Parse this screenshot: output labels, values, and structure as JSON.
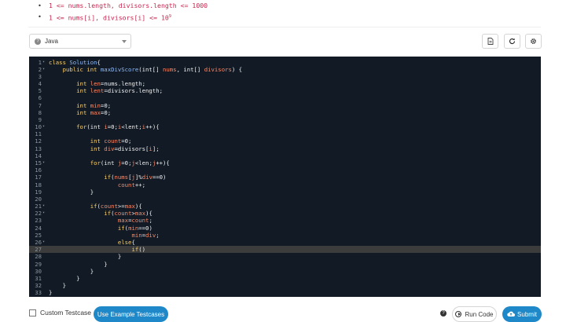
{
  "constraints": [
    {
      "text": "1 <= nums.length, divisors.length <= 1000"
    },
    {
      "text": "1 <= nums[i], divisors[i] <= 10",
      "sup": "9"
    }
  ],
  "language": {
    "selected": "Java"
  },
  "toolbar": {
    "file_icon": "file-icon",
    "refresh_icon": "refresh-icon",
    "settings_icon": "gear-icon"
  },
  "editor": {
    "active_line": 27,
    "lines": [
      {
        "n": "1",
        "fold": true,
        "t": [
          [
            "kw",
            "class "
          ],
          [
            "cls",
            "Solution"
          ],
          [
            "",
            "{"
          ]
        ]
      },
      {
        "n": "2",
        "fold": true,
        "t": [
          [
            "",
            "    "
          ],
          [
            "kw",
            "public int "
          ],
          [
            "cls",
            "maxDivScore"
          ],
          [
            "",
            "(int[] "
          ],
          [
            "id",
            "nums"
          ],
          [
            "",
            ", int[] "
          ],
          [
            "id",
            "divisors"
          ],
          [
            "",
            ") {"
          ]
        ]
      },
      {
        "n": "3",
        "t": []
      },
      {
        "n": "4",
        "t": [
          [
            "",
            "        "
          ],
          [
            "kw",
            "int "
          ],
          [
            "id",
            "len"
          ],
          [
            "",
            "=nums.length;"
          ]
        ]
      },
      {
        "n": "5",
        "t": [
          [
            "",
            "        "
          ],
          [
            "kw",
            "int "
          ],
          [
            "id",
            "lent"
          ],
          [
            "",
            "=divisors.length;"
          ]
        ]
      },
      {
        "n": "6",
        "t": []
      },
      {
        "n": "7",
        "t": [
          [
            "",
            "        "
          ],
          [
            "kw",
            "int "
          ],
          [
            "id",
            "min"
          ],
          [
            "",
            "=0;"
          ]
        ]
      },
      {
        "n": "8",
        "t": [
          [
            "",
            "        "
          ],
          [
            "kw",
            "int "
          ],
          [
            "id",
            "max"
          ],
          [
            "",
            "=0;"
          ]
        ]
      },
      {
        "n": "9",
        "t": []
      },
      {
        "n": "10",
        "fold": true,
        "t": [
          [
            "",
            "        "
          ],
          [
            "kw",
            "for"
          ],
          [
            "",
            "(int "
          ],
          [
            "id",
            "i"
          ],
          [
            "",
            "=0;"
          ],
          [
            "id",
            "i"
          ],
          [
            "",
            "<lent;"
          ],
          [
            "id",
            "i"
          ],
          [
            "",
            "++){"
          ]
        ]
      },
      {
        "n": "11",
        "t": []
      },
      {
        "n": "12",
        "t": [
          [
            "",
            "            "
          ],
          [
            "kw",
            "int "
          ],
          [
            "id",
            "count"
          ],
          [
            "",
            "=0;"
          ]
        ]
      },
      {
        "n": "13",
        "t": [
          [
            "",
            "            "
          ],
          [
            "kw",
            "int "
          ],
          [
            "id",
            "div"
          ],
          [
            "",
            "=divisors["
          ],
          [
            "id",
            "i"
          ],
          [
            "",
            "];"
          ]
        ]
      },
      {
        "n": "14",
        "t": []
      },
      {
        "n": "15",
        "fold": true,
        "t": [
          [
            "",
            "            "
          ],
          [
            "kw",
            "for"
          ],
          [
            "",
            "(int "
          ],
          [
            "id",
            "j"
          ],
          [
            "",
            "=0;"
          ],
          [
            "id",
            "j"
          ],
          [
            "",
            "<len;"
          ],
          [
            "id",
            "j"
          ],
          [
            "",
            "++){"
          ]
        ]
      },
      {
        "n": "16",
        "t": []
      },
      {
        "n": "17",
        "t": [
          [
            "",
            "                "
          ],
          [
            "kw",
            "if"
          ],
          [
            "",
            "("
          ],
          [
            "id",
            "nums"
          ],
          [
            "",
            "["
          ],
          [
            "id",
            "j"
          ],
          [
            "",
            "]%"
          ],
          [
            "id",
            "div"
          ],
          [
            "",
            "==0)"
          ]
        ]
      },
      {
        "n": "18",
        "t": [
          [
            "",
            "                    "
          ],
          [
            "id",
            "count"
          ],
          [
            "",
            "++;"
          ]
        ]
      },
      {
        "n": "19",
        "t": [
          [
            "",
            "            }"
          ]
        ]
      },
      {
        "n": "20",
        "t": []
      },
      {
        "n": "21",
        "fold": true,
        "t": [
          [
            "",
            "            "
          ],
          [
            "kw",
            "if"
          ],
          [
            "",
            "("
          ],
          [
            "id",
            "count"
          ],
          [
            "",
            ">="
          ],
          [
            "id",
            "max"
          ],
          [
            "",
            "){"
          ]
        ]
      },
      {
        "n": "22",
        "fold": true,
        "t": [
          [
            "",
            "                "
          ],
          [
            "kw",
            "if"
          ],
          [
            "",
            "("
          ],
          [
            "id",
            "count"
          ],
          [
            "",
            ">"
          ],
          [
            "id",
            "max"
          ],
          [
            "",
            "){"
          ]
        ]
      },
      {
        "n": "23",
        "t": [
          [
            "",
            "                    "
          ],
          [
            "id",
            "max"
          ],
          [
            "",
            "="
          ],
          [
            "id",
            "count"
          ],
          [
            "",
            ";"
          ]
        ]
      },
      {
        "n": "24",
        "t": [
          [
            "",
            "                    "
          ],
          [
            "kw",
            "if"
          ],
          [
            "",
            "("
          ],
          [
            "id",
            "min"
          ],
          [
            "",
            "==0)"
          ]
        ]
      },
      {
        "n": "25",
        "t": [
          [
            "",
            "                        "
          ],
          [
            "id",
            "min"
          ],
          [
            "",
            "="
          ],
          [
            "id",
            "div"
          ],
          [
            "",
            ";"
          ]
        ]
      },
      {
        "n": "26",
        "fold": true,
        "t": [
          [
            "",
            "                    "
          ],
          [
            "kw",
            "else"
          ],
          [
            "",
            "{"
          ]
        ]
      },
      {
        "n": "27",
        "t": [
          [
            "",
            "                        "
          ],
          [
            "kw",
            "if"
          ],
          [
            "",
            "()"
          ]
        ]
      },
      {
        "n": "28",
        "t": [
          [
            "",
            "                "
          ],
          [
            "",
            "    }"
          ]
        ]
      },
      {
        "n": "29",
        "t": [
          [
            "",
            "                }"
          ]
        ]
      },
      {
        "n": "30",
        "t": [
          [
            "",
            "            }"
          ]
        ]
      },
      {
        "n": "31",
        "t": [
          [
            "",
            "        }"
          ]
        ]
      },
      {
        "n": "32",
        "t": [
          [
            "",
            "    }"
          ]
        ]
      },
      {
        "n": "33",
        "t": [
          [
            "",
            "}"
          ]
        ]
      }
    ]
  },
  "footer": {
    "custom_testcase_label": "Custom Testcase",
    "use_example_label": "Use Example Testcases",
    "run_label": "Run Code",
    "submit_label": "Submit"
  }
}
